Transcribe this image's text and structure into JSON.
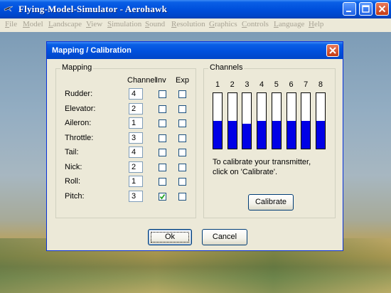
{
  "window": {
    "title": "Flying-Model-Simulator - Aerohawk",
    "controls": [
      "minimize-icon",
      "maximize-icon",
      "close-icon"
    ]
  },
  "menu": [
    "File",
    "Model",
    "Landscape",
    "View",
    "Simulation",
    "Sound",
    "Resolution",
    "Graphics",
    "Controls",
    "Language",
    "Help"
  ],
  "dialog": {
    "title": "Mapping / Calibration",
    "mapping": {
      "label": "Mapping",
      "headers": {
        "channel": "Channel",
        "inv": "Inv",
        "exp": "Exp"
      },
      "rows": [
        {
          "label": "Rudder:",
          "channel": "4",
          "inv": false,
          "exp": false
        },
        {
          "label": "Elevator:",
          "channel": "2",
          "inv": false,
          "exp": false
        },
        {
          "label": "Aileron:",
          "channel": "1",
          "inv": false,
          "exp": false
        },
        {
          "label": "Throttle:",
          "channel": "3",
          "inv": false,
          "exp": false
        },
        {
          "label": "Tail:",
          "channel": "4",
          "inv": false,
          "exp": false
        },
        {
          "label": "Nick:",
          "channel": "2",
          "inv": false,
          "exp": false
        },
        {
          "label": "Roll:",
          "channel": "1",
          "inv": false,
          "exp": false
        },
        {
          "label": "Pitch:",
          "channel": "3",
          "inv": true,
          "exp": false
        }
      ]
    },
    "channels": {
      "label": "Channels",
      "numbers": [
        "1",
        "2",
        "3",
        "4",
        "5",
        "6",
        "7",
        "8"
      ],
      "levels": [
        0.5,
        0.5,
        0.45,
        0.5,
        0.5,
        0.5,
        0.5,
        0.5
      ],
      "bar_color": "#0000e6",
      "text": "To calibrate your transmitter, click on 'Calibrate'.",
      "calibrate_label": "Calibrate"
    },
    "ok_label": "Ok",
    "cancel_label": "Cancel"
  }
}
